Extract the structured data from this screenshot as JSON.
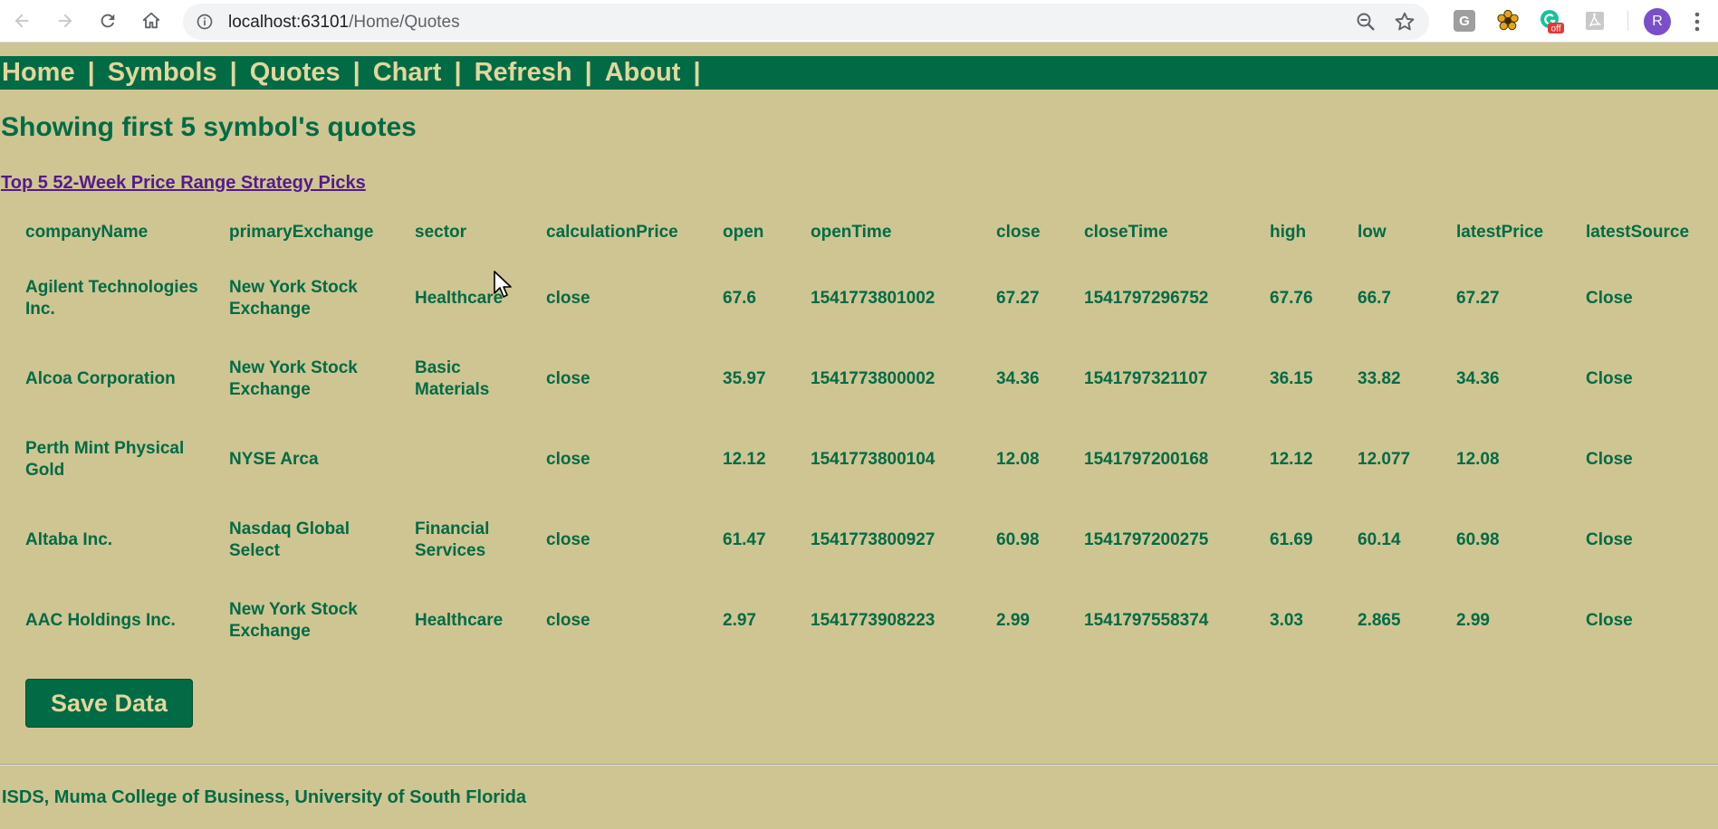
{
  "browser": {
    "url_host": "localhost:63101",
    "url_path": "/Home/Quotes",
    "profile_initial": "R",
    "extension_badge": "off",
    "extension_g_letter": "G",
    "icons": [
      "back-icon",
      "forward-icon",
      "reload-icon",
      "home-icon",
      "info-icon",
      "zoom-icon",
      "star-icon",
      "menu-dots-icon"
    ]
  },
  "nav": {
    "items": [
      {
        "label": "Home"
      },
      {
        "label": "Symbols"
      },
      {
        "label": "Quotes"
      },
      {
        "label": "Chart"
      },
      {
        "label": "Refresh"
      },
      {
        "label": "About"
      }
    ],
    "separator": "|"
  },
  "heading": "Showing first 5 symbol's quotes",
  "picks_link": "Top 5 52-Week Price Range Strategy Picks",
  "table": {
    "columns": [
      "companyName",
      "primaryExchange",
      "sector",
      "calculationPrice",
      "open",
      "openTime",
      "close",
      "closeTime",
      "high",
      "low",
      "latestPrice",
      "latestSource"
    ],
    "rows": [
      [
        "Agilent Technologies Inc.",
        "New York Stock Exchange",
        "Healthcare",
        "close",
        "67.6",
        "1541773801002",
        "67.27",
        "1541797296752",
        "67.76",
        "66.7",
        "67.27",
        "Close"
      ],
      [
        "Alcoa Corporation",
        "New York Stock Exchange",
        "Basic Materials",
        "close",
        "35.97",
        "1541773800002",
        "34.36",
        "1541797321107",
        "36.15",
        "33.82",
        "34.36",
        "Close"
      ],
      [
        "Perth Mint Physical Gold",
        "NYSE Arca",
        "",
        "close",
        "12.12",
        "1541773800104",
        "12.08",
        "1541797200168",
        "12.12",
        "12.077",
        "12.08",
        "Close"
      ],
      [
        "Altaba Inc.",
        "Nasdaq Global Select",
        "Financial Services",
        "close",
        "61.47",
        "1541773800927",
        "60.98",
        "1541797200275",
        "61.69",
        "60.14",
        "60.98",
        "Close"
      ],
      [
        "AAC Holdings Inc.",
        "New York Stock Exchange",
        "Healthcare",
        "close",
        "2.97",
        "1541773908223",
        "2.99",
        "1541797558374",
        "3.03",
        "2.865",
        "2.99",
        "Close"
      ]
    ]
  },
  "save_button": "Save Data",
  "footer": "ISDS, Muma College of Business, University of South Florida",
  "colors": {
    "page_bg": "#cfc593",
    "brand_green": "#006b45",
    "nav_text": "#e3d69d",
    "link_visited": "#551a8b"
  }
}
